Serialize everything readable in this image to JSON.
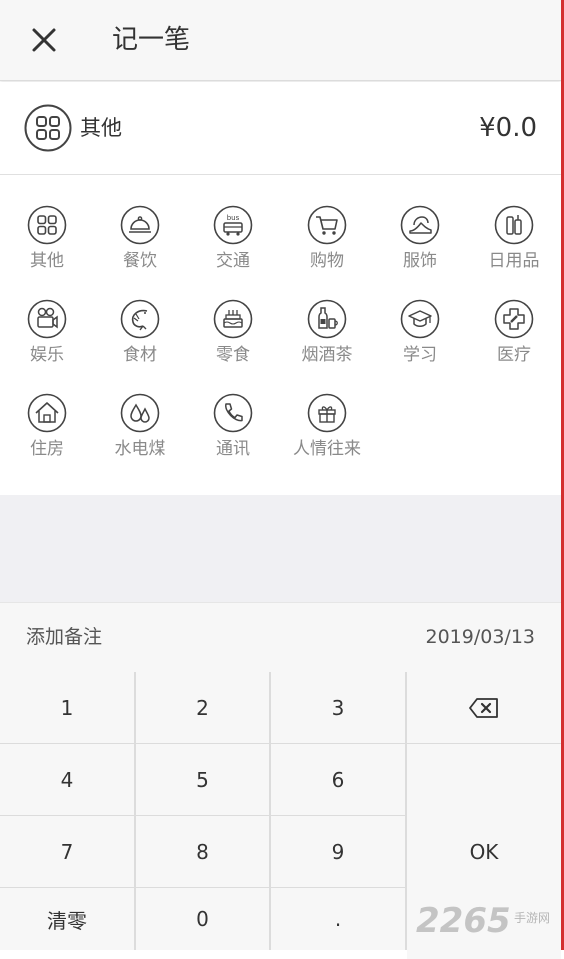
{
  "header": {
    "title": "记一笔",
    "close_icon": "close-icon"
  },
  "selected": {
    "label": "其他",
    "icon": "grid-icon",
    "amount": "¥0.0"
  },
  "categories": [
    {
      "label": "其他",
      "icon": "grid-icon"
    },
    {
      "label": "餐饮",
      "icon": "dish-cover-icon"
    },
    {
      "label": "交通",
      "icon": "bus-icon"
    },
    {
      "label": "购物",
      "icon": "shopping-cart-icon"
    },
    {
      "label": "服饰",
      "icon": "high-heel-icon"
    },
    {
      "label": "日用品",
      "icon": "toiletries-icon"
    },
    {
      "label": "娱乐",
      "icon": "film-camera-icon"
    },
    {
      "label": "食材",
      "icon": "shrimp-icon"
    },
    {
      "label": "零食",
      "icon": "cake-icon"
    },
    {
      "label": "烟酒茶",
      "icon": "bottle-cup-icon"
    },
    {
      "label": "学习",
      "icon": "graduation-cap-icon"
    },
    {
      "label": "医疗",
      "icon": "medical-cross-icon"
    },
    {
      "label": "住房",
      "icon": "house-icon"
    },
    {
      "label": "水电煤",
      "icon": "water-drops-icon"
    },
    {
      "label": "通讯",
      "icon": "phone-icon"
    },
    {
      "label": "人情往来",
      "icon": "gift-icon"
    }
  ],
  "note": {
    "label": "添加备注",
    "date": "2019/03/13"
  },
  "keypad": {
    "k1": "1",
    "k2": "2",
    "k3": "3",
    "k4": "4",
    "k5": "5",
    "k6": "6",
    "k7": "7",
    "k8": "8",
    "k9": "9",
    "clear": "清零",
    "k0": "0",
    "dot": ".",
    "ok": "OK",
    "backspace_icon": "backspace-icon"
  },
  "watermark": {
    "text": "2265",
    "sub": "手游网"
  },
  "colors": {
    "accent_edge": "#d32f2f",
    "icon_stroke": "#444444",
    "label_gray": "#8a8a8a"
  }
}
